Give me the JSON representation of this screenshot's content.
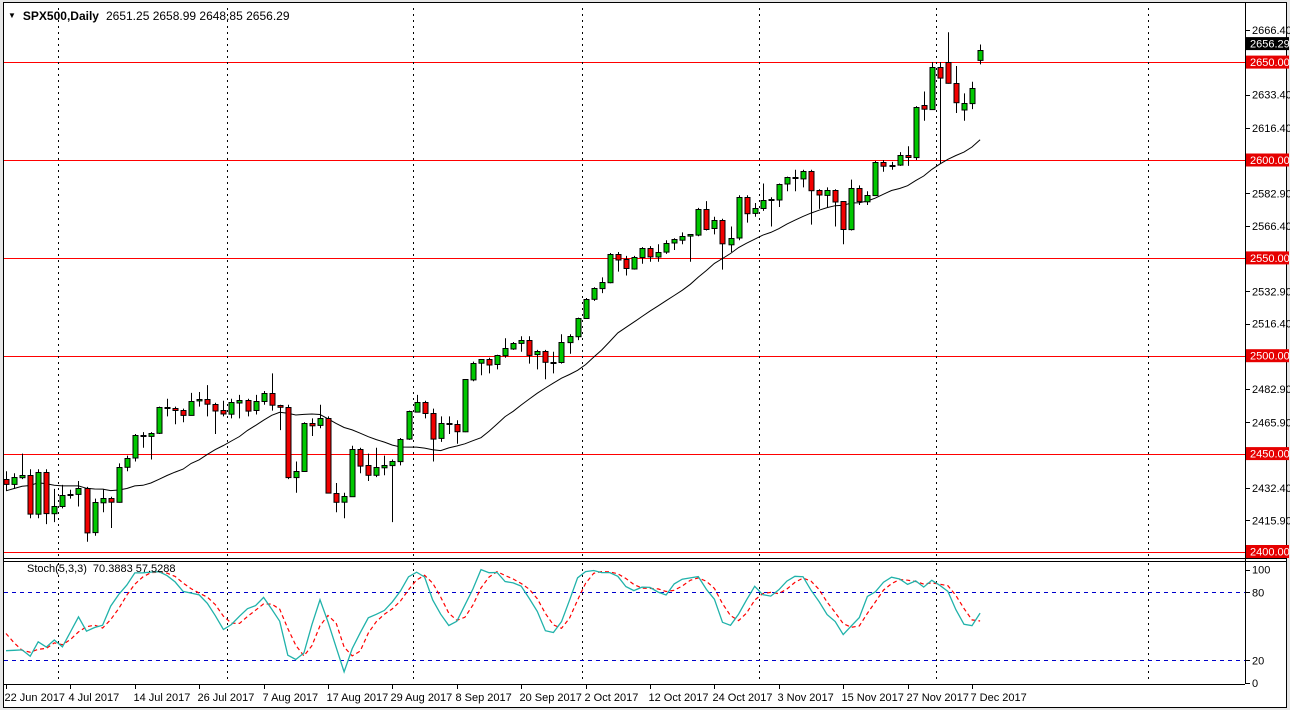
{
  "header": {
    "title_symbol": "SPX500,Daily",
    "title_ohlc": "2651.25 2658.99 2648.85 2656.29"
  },
  "indicator": {
    "name": "Stoch(5,3,3)",
    "values": "70.3883 57.5288",
    "k_period": 5,
    "slowing": 3,
    "d_period": 3,
    "levels": [
      80,
      20
    ],
    "axis_labels": [
      "100",
      "80",
      "20",
      "0"
    ]
  },
  "price_axis": {
    "labels": [
      {
        "text": "2666.40",
        "value": 2666.4,
        "kind": "tick"
      },
      {
        "text": "2656.29",
        "value": 2656.29,
        "kind": "current"
      },
      {
        "text": "2650.00",
        "value": 2650.0,
        "kind": "level"
      },
      {
        "text": "2633.40",
        "value": 2633.4,
        "kind": "tick"
      },
      {
        "text": "2616.40",
        "value": 2616.4,
        "kind": "tick"
      },
      {
        "text": "2600.00",
        "value": 2600.0,
        "kind": "level"
      },
      {
        "text": "2582.90",
        "value": 2582.9,
        "kind": "tick"
      },
      {
        "text": "2566.40",
        "value": 2566.4,
        "kind": "tick"
      },
      {
        "text": "2550.00",
        "value": 2550.0,
        "kind": "level"
      },
      {
        "text": "2532.90",
        "value": 2532.9,
        "kind": "tick"
      },
      {
        "text": "2516.40",
        "value": 2516.4,
        "kind": "tick"
      },
      {
        "text": "2500.00",
        "value": 2500.0,
        "kind": "level"
      },
      {
        "text": "2482.90",
        "value": 2482.9,
        "kind": "tick"
      },
      {
        "text": "2465.90",
        "value": 2465.9,
        "kind": "tick"
      },
      {
        "text": "2450.00",
        "value": 2450.0,
        "kind": "level"
      },
      {
        "text": "2432.40",
        "value": 2432.4,
        "kind": "tick"
      },
      {
        "text": "2415.90",
        "value": 2415.9,
        "kind": "tick"
      },
      {
        "text": "2400.00",
        "value": 2400.0,
        "kind": "level"
      }
    ]
  },
  "time_axis": {
    "labels": [
      {
        "text": "22 Jun 2017",
        "idx": 0
      },
      {
        "text": "4 Jul 2017",
        "idx": 8
      },
      {
        "text": "14 Jul 2017",
        "idx": 16
      },
      {
        "text": "26 Jul 2017",
        "idx": 24
      },
      {
        "text": "7 Aug 2017",
        "idx": 32
      },
      {
        "text": "17 Aug 2017",
        "idx": 40
      },
      {
        "text": "29 Aug 2017",
        "idx": 48
      },
      {
        "text": "8 Sep 2017",
        "idx": 56
      },
      {
        "text": "20 Sep 2017",
        "idx": 64
      },
      {
        "text": "2 Oct 2017",
        "idx": 72
      },
      {
        "text": "12 Oct 2017",
        "idx": 80
      },
      {
        "text": "24 Oct 2017",
        "idx": 88
      },
      {
        "text": "3 Nov 2017",
        "idx": 96
      },
      {
        "text": "15 Nov 2017",
        "idx": 104
      },
      {
        "text": "27 Nov 2017",
        "idx": 112
      },
      {
        "text": "7 Dec 2017",
        "idx": 120
      }
    ]
  },
  "level_lines": [
    2650,
    2600,
    2550,
    2500,
    2450,
    2400
  ],
  "separators": {
    "month_start_idx": [
      7,
      28,
      51,
      72,
      94,
      116
    ],
    "extra_x": [
      1148
    ]
  },
  "colors": {
    "bull": "#00c800",
    "bear": "#f20000",
    "candle_border": "#000000",
    "wick": "#000000",
    "ma": "#000000",
    "level_line": "#ff0000",
    "level_badge": "#e60000",
    "current_badge": "#000000",
    "badge_text": "#ffffff",
    "stoch_k": "#20b2aa",
    "stoch_d": "#ff0000",
    "stoch_level": "#0000cd",
    "separator": "#000000",
    "axis_text": "#000000",
    "bg": "#ffffff",
    "frame": "#000000"
  },
  "chart_data": {
    "type": "candlestick",
    "symbol": "SPX500",
    "timeframe": "Daily",
    "title": "SPX500,Daily",
    "ylim": [
      2395,
      2678
    ],
    "ma_period": 20,
    "pre_closes": [
      2415,
      2416,
      2412,
      2412,
      2430,
      2439,
      2436,
      2429,
      2433,
      2434,
      2432,
      2429,
      2440,
      2438,
      2432,
      2433,
      2453,
      2437,
      2436
    ],
    "candles": [
      [
        "2017-06-22",
        2437.0,
        2441.0,
        2431.0,
        2434.5
      ],
      [
        "2017-06-23",
        2434.5,
        2440.0,
        2432.0,
        2438.0
      ],
      [
        "2017-06-26",
        2438.0,
        2450.0,
        2437.0,
        2439.1
      ],
      [
        "2017-06-27",
        2439.1,
        2442.0,
        2417.0,
        2419.4
      ],
      [
        "2017-06-28",
        2419.4,
        2442.0,
        2417.0,
        2440.7
      ],
      [
        "2017-06-29",
        2440.7,
        2442.0,
        2414.0,
        2419.7
      ],
      [
        "2017-06-30",
        2419.7,
        2432.0,
        2415.0,
        2423.4
      ],
      [
        "2017-07-03",
        2423.4,
        2434.0,
        2422.0,
        2429.0
      ],
      [
        "2017-07-04",
        2429.0,
        2431.5,
        2427.0,
        2429.5
      ],
      [
        "2017-07-05",
        2429.5,
        2436.0,
        2423.0,
        2432.5
      ],
      [
        "2017-07-06",
        2432.5,
        2433.0,
        2405.0,
        2409.8
      ],
      [
        "2017-07-07",
        2409.8,
        2427.0,
        2408.0,
        2425.2
      ],
      [
        "2017-07-10",
        2425.2,
        2432.0,
        2420.0,
        2427.4
      ],
      [
        "2017-07-11",
        2427.4,
        2428.0,
        2412.0,
        2425.5
      ],
      [
        "2017-07-12",
        2425.5,
        2445.0,
        2425.0,
        2443.3
      ],
      [
        "2017-07-13",
        2443.3,
        2449.0,
        2441.0,
        2447.8
      ],
      [
        "2017-07-14",
        2447.8,
        2460.0,
        2446.0,
        2459.3
      ],
      [
        "2017-07-17",
        2459.3,
        2461.0,
        2453.0,
        2459.1
      ],
      [
        "2017-07-18",
        2459.1,
        2461.0,
        2447.0,
        2460.6
      ],
      [
        "2017-07-19",
        2460.6,
        2474.0,
        2460.0,
        2473.8
      ],
      [
        "2017-07-20",
        2473.8,
        2478.0,
        2469.0,
        2473.5
      ],
      [
        "2017-07-21",
        2473.5,
        2474.0,
        2465.0,
        2472.5
      ],
      [
        "2017-07-24",
        2472.5,
        2473.0,
        2466.0,
        2470.0
      ],
      [
        "2017-07-25",
        2470.0,
        2481.0,
        2470.0,
        2477.1
      ],
      [
        "2017-07-26",
        2477.1,
        2481.5,
        2474.0,
        2477.8
      ],
      [
        "2017-07-27",
        2477.8,
        2485.0,
        2469.0,
        2475.4
      ],
      [
        "2017-07-28",
        2475.4,
        2476.0,
        2460.0,
        2472.1
      ],
      [
        "2017-07-31",
        2472.1,
        2477.0,
        2469.0,
        2470.3
      ],
      [
        "2017-08-01",
        2470.3,
        2478.0,
        2468.0,
        2476.3
      ],
      [
        "2017-08-02",
        2476.3,
        2480.0,
        2468.0,
        2477.6
      ],
      [
        "2017-08-03",
        2477.6,
        2478.0,
        2469.0,
        2472.2
      ],
      [
        "2017-08-04",
        2472.2,
        2480.0,
        2470.0,
        2476.8
      ],
      [
        "2017-08-07",
        2476.8,
        2482.0,
        2475.0,
        2480.9
      ],
      [
        "2017-08-08",
        2480.9,
        2491.0,
        2472.0,
        2474.9
      ],
      [
        "2017-08-09",
        2474.9,
        2475.0,
        2462.0,
        2474.0
      ],
      [
        "2017-08-10",
        2474.0,
        2475.0,
        2437.0,
        2438.2
      ],
      [
        "2017-08-11",
        2438.2,
        2446.0,
        2430.0,
        2441.3
      ],
      [
        "2017-08-14",
        2441.3,
        2466.0,
        2441.0,
        2465.8
      ],
      [
        "2017-08-15",
        2465.8,
        2468.0,
        2459.0,
        2464.6
      ],
      [
        "2017-08-16",
        2464.6,
        2475.0,
        2463.0,
        2468.1
      ],
      [
        "2017-08-17",
        2468.1,
        2469.0,
        2430.0,
        2430.0
      ],
      [
        "2017-08-18",
        2430.0,
        2435.0,
        2420.0,
        2425.5
      ],
      [
        "2017-08-21",
        2425.5,
        2430.0,
        2417.0,
        2428.4
      ],
      [
        "2017-08-22",
        2428.4,
        2454.0,
        2428.0,
        2452.5
      ],
      [
        "2017-08-23",
        2452.5,
        2453.0,
        2440.0,
        2444.0
      ],
      [
        "2017-08-24",
        2444.0,
        2450.0,
        2436.0,
        2439.0
      ],
      [
        "2017-08-25",
        2439.0,
        2453.0,
        2438.0,
        2443.0
      ],
      [
        "2017-08-28",
        2443.0,
        2449.0,
        2439.0,
        2444.2
      ],
      [
        "2017-08-29",
        2444.2,
        2447.0,
        2415.0,
        2446.3
      ],
      [
        "2017-08-30",
        2446.3,
        2458.0,
        2444.0,
        2457.6
      ],
      [
        "2017-08-31",
        2457.6,
        2472.0,
        2457.0,
        2471.7
      ],
      [
        "2017-09-01",
        2471.7,
        2480.0,
        2471.0,
        2476.6
      ],
      [
        "2017-09-04",
        2476.6,
        2477.0,
        2468.0,
        2471.0
      ],
      [
        "2017-09-05",
        2471.0,
        2473.0,
        2446.0,
        2457.9
      ],
      [
        "2017-09-06",
        2457.9,
        2469.0,
        2456.0,
        2465.5
      ],
      [
        "2017-09-07",
        2465.5,
        2469.0,
        2460.0,
        2465.1
      ],
      [
        "2017-09-08",
        2465.1,
        2467.0,
        2455.0,
        2461.4
      ],
      [
        "2017-09-11",
        2461.4,
        2488.0,
        2461.0,
        2488.1
      ],
      [
        "2017-09-12",
        2488.1,
        2497.0,
        2487.0,
        2496.5
      ],
      [
        "2017-09-13",
        2496.5,
        2498.0,
        2490.0,
        2498.4
      ],
      [
        "2017-09-14",
        2498.4,
        2499.0,
        2491.0,
        2495.6
      ],
      [
        "2017-09-15",
        2495.6,
        2500.5,
        2493.0,
        2500.2
      ],
      [
        "2017-09-18",
        2500.2,
        2508.9,
        2499.0,
        2503.9
      ],
      [
        "2017-09-19",
        2503.9,
        2507.0,
        2503.0,
        2506.7
      ],
      [
        "2017-09-20",
        2506.7,
        2510.0,
        2502.0,
        2508.2
      ],
      [
        "2017-09-21",
        2508.2,
        2510.0,
        2496.0,
        2500.6
      ],
      [
        "2017-09-22",
        2500.6,
        2503.0,
        2493.0,
        2502.2
      ],
      [
        "2017-09-25",
        2502.2,
        2503.0,
        2488.0,
        2496.7
      ],
      [
        "2017-09-26",
        2496.7,
        2502.0,
        2491.0,
        2496.8
      ],
      [
        "2017-09-27",
        2496.8,
        2511.0,
        2496.0,
        2507.0
      ],
      [
        "2017-09-28",
        2507.0,
        2511.0,
        2501.0,
        2510.1
      ],
      [
        "2017-09-29",
        2510.1,
        2519.5,
        2508.0,
        2519.4
      ],
      [
        "2017-10-02",
        2519.4,
        2529.5,
        2519.0,
        2529.1
      ],
      [
        "2017-10-03",
        2529.1,
        2535.0,
        2528.0,
        2534.6
      ],
      [
        "2017-10-04",
        2534.6,
        2540.0,
        2532.0,
        2537.7
      ],
      [
        "2017-10-05",
        2537.7,
        2552.5,
        2537.0,
        2552.1
      ],
      [
        "2017-10-06",
        2552.1,
        2553.0,
        2543.0,
        2549.3
      ],
      [
        "2017-10-09",
        2549.3,
        2551.0,
        2541.0,
        2544.7
      ],
      [
        "2017-10-10",
        2544.7,
        2551.0,
        2544.0,
        2550.6
      ],
      [
        "2017-10-11",
        2550.6,
        2555.5,
        2547.0,
        2555.2
      ],
      [
        "2017-10-12",
        2555.2,
        2556.0,
        2548.0,
        2550.9
      ],
      [
        "2017-10-13",
        2550.9,
        2557.0,
        2548.0,
        2553.2
      ],
      [
        "2017-10-16",
        2553.2,
        2559.0,
        2552.0,
        2557.6
      ],
      [
        "2017-10-17",
        2557.6,
        2560.0,
        2554.0,
        2559.4
      ],
      [
        "2017-10-18",
        2559.4,
        2563.0,
        2557.0,
        2561.3
      ],
      [
        "2017-10-19",
        2561.3,
        2562.0,
        2548.0,
        2562.1
      ],
      [
        "2017-10-20",
        2562.1,
        2575.5,
        2561.0,
        2575.2
      ],
      [
        "2017-10-23",
        2575.2,
        2579.0,
        2564.0,
        2565.0
      ],
      [
        "2017-10-24",
        2565.0,
        2571.0,
        2562.0,
        2569.1
      ],
      [
        "2017-10-25",
        2569.1,
        2570.0,
        2544.0,
        2557.2
      ],
      [
        "2017-10-26",
        2557.2,
        2566.0,
        2553.0,
        2560.4
      ],
      [
        "2017-10-27",
        2560.4,
        2582.0,
        2559.0,
        2581.1
      ],
      [
        "2017-10-30",
        2581.1,
        2582.0,
        2568.0,
        2572.8
      ],
      [
        "2017-10-31",
        2572.8,
        2578.0,
        2571.0,
        2575.3
      ],
      [
        "2017-11-01",
        2575.3,
        2588.0,
        2574.0,
        2579.4
      ],
      [
        "2017-11-02",
        2579.4,
        2581.0,
        2566.0,
        2579.9
      ],
      [
        "2017-11-03",
        2579.9,
        2588.0,
        2576.0,
        2587.8
      ],
      [
        "2017-11-06",
        2587.8,
        2591.5,
        2584.0,
        2591.1
      ],
      [
        "2017-11-07",
        2591.1,
        2595.0,
        2584.0,
        2590.6
      ],
      [
        "2017-11-08",
        2590.6,
        2595.0,
        2586.0,
        2594.4
      ],
      [
        "2017-11-09",
        2594.4,
        2595.0,
        2567.0,
        2584.6
      ],
      [
        "2017-11-10",
        2584.6,
        2585.0,
        2575.0,
        2582.3
      ],
      [
        "2017-11-13",
        2582.3,
        2586.0,
        2576.0,
        2584.8
      ],
      [
        "2017-11-14",
        2584.8,
        2585.0,
        2566.0,
        2578.9
      ],
      [
        "2017-11-15",
        2578.9,
        2579.0,
        2557.0,
        2564.6
      ],
      [
        "2017-11-16",
        2564.6,
        2590.0,
        2564.0,
        2585.6
      ],
      [
        "2017-11-17",
        2585.6,
        2587.0,
        2577.0,
        2578.9
      ],
      [
        "2017-11-20",
        2578.9,
        2584.0,
        2577.0,
        2582.1
      ],
      [
        "2017-11-21",
        2582.1,
        2599.5,
        2582.0,
        2599.0
      ],
      [
        "2017-11-22",
        2599.0,
        2600.0,
        2594.0,
        2597.1
      ],
      [
        "2017-11-23",
        2597.1,
        2599.0,
        2595.0,
        2597.5
      ],
      [
        "2017-11-24",
        2597.5,
        2604.0,
        2597.0,
        2602.4
      ],
      [
        "2017-11-27",
        2602.4,
        2607.0,
        2597.0,
        2601.4
      ],
      [
        "2017-11-28",
        2601.4,
        2627.5,
        2600.0,
        2627.0
      ],
      [
        "2017-11-29",
        2628.0,
        2635.0,
        2620.0,
        2626.1
      ],
      [
        "2017-11-30",
        2626.1,
        2650.0,
        2626.0,
        2647.6
      ],
      [
        "2017-12-01",
        2647.6,
        2650.0,
        2598.0,
        2642.2
      ],
      [
        "2017-12-04",
        2650.0,
        2665.2,
        2639.0,
        2639.4
      ],
      [
        "2017-12-05",
        2639.4,
        2648.0,
        2624.0,
        2629.6
      ],
      [
        "2017-12-06",
        2626.0,
        2634.0,
        2620.0,
        2629.3
      ],
      [
        "2017-12-07",
        2629.3,
        2640.0,
        2626.0,
        2637.0
      ],
      [
        "2017-12-08",
        2651.25,
        2658.99,
        2648.85,
        2656.29
      ]
    ]
  }
}
